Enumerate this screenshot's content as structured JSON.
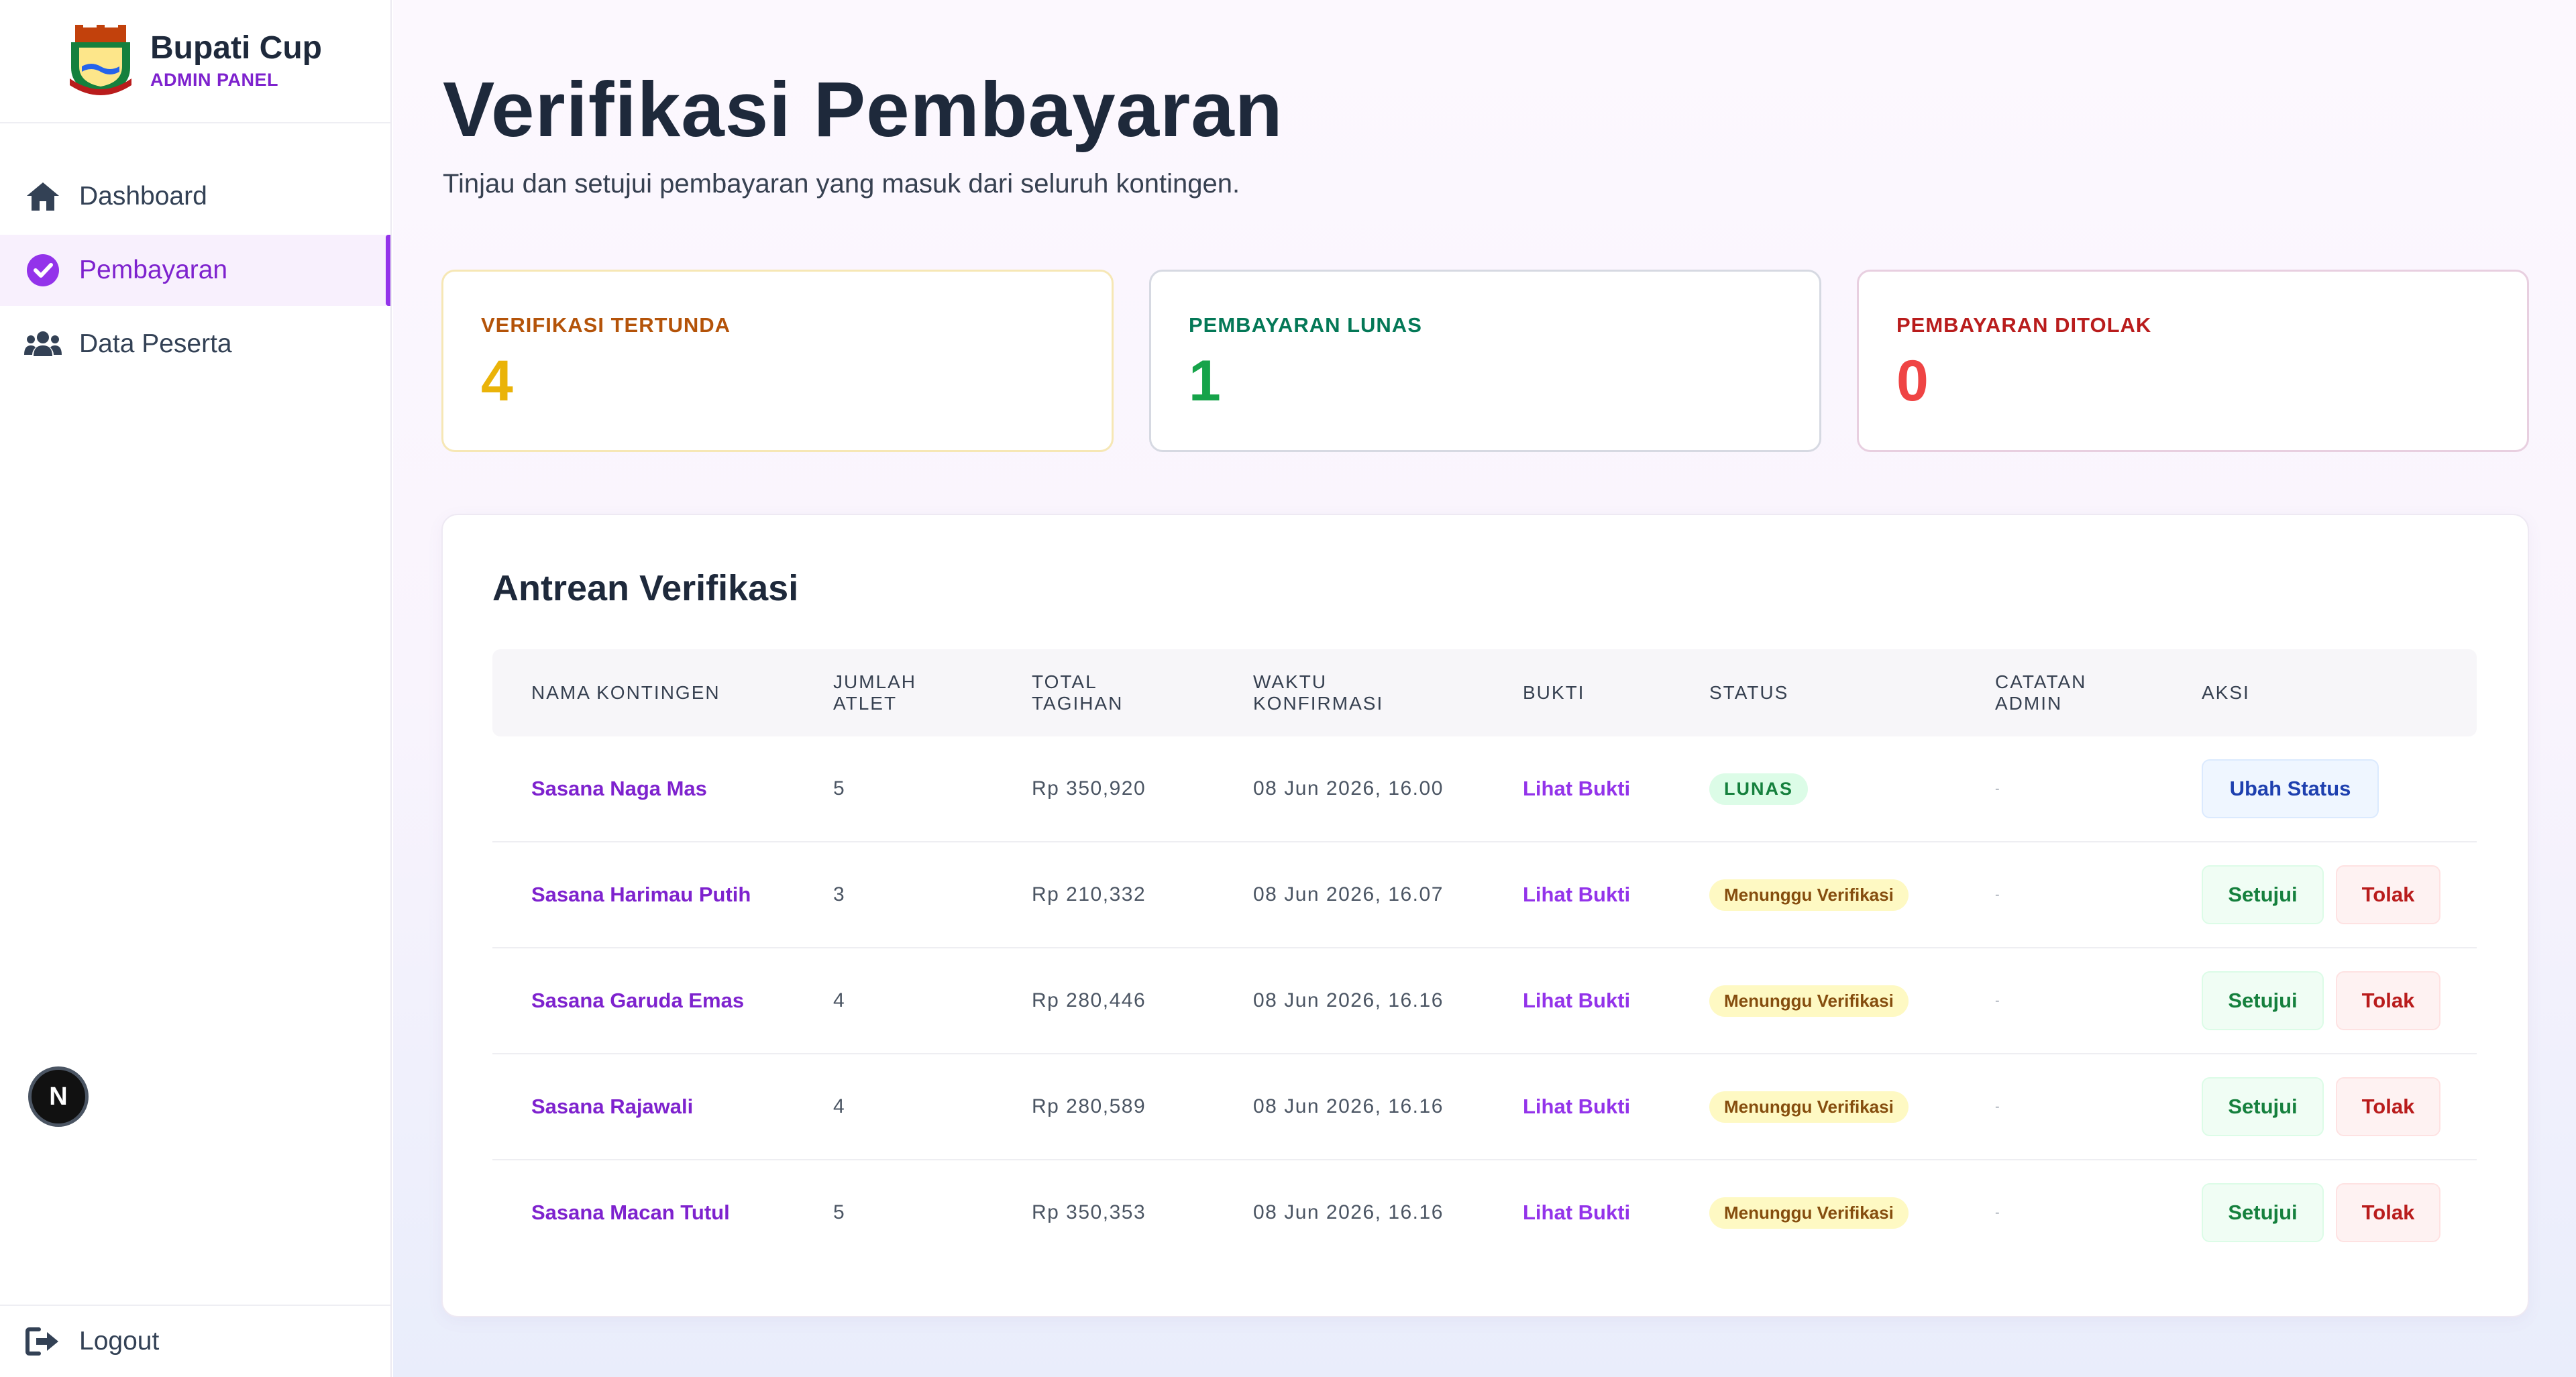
{
  "brand": {
    "title": "Bupati Cup",
    "subtitle": "ADMIN PANEL"
  },
  "nav": [
    {
      "label": "Dashboard",
      "icon": "home-icon",
      "active": false
    },
    {
      "label": "Pembayaran",
      "icon": "check-circle-icon",
      "active": true
    },
    {
      "label": "Data Peserta",
      "icon": "users-icon",
      "active": false
    }
  ],
  "dev_badge": "N",
  "logout_label": "Logout",
  "page": {
    "title": "Verifikasi Pembayaran",
    "subtitle": "Tinjau dan setujui pembayaran yang masuk dari seluruh kontingen."
  },
  "stats": {
    "pending": {
      "label": "VERIFIKASI TERTUNDA",
      "value": "4",
      "color": "#eab308"
    },
    "paid": {
      "label": "PEMBAYARAN LUNAS",
      "value": "1",
      "color": "#16a34a"
    },
    "rejected": {
      "label": "PEMBAYARAN DITOLAK",
      "value": "0",
      "color": "#ef4444"
    }
  },
  "queue": {
    "title": "Antrean Verifikasi",
    "headers": {
      "name": "NAMA KONTINGEN",
      "athletes_1": "JUMLAH",
      "athletes_2": "ATLET",
      "total_1": "TOTAL",
      "total_2": "TAGIHAN",
      "time_1": "WAKTU",
      "time_2": "KONFIRMASI",
      "proof": "BUKTI",
      "status": "STATUS",
      "note_1": "CATATAN",
      "note_2": "ADMIN",
      "action": "AKSI"
    },
    "rows": [
      {
        "name": "Sasana Naga Mas",
        "athletes": "5",
        "total": "Rp 350,920",
        "time": "08 Jun 2026, 16.00",
        "proof": "Lihat Bukti",
        "status": "LUNAS",
        "note": "-",
        "actions": [
          "Ubah Status"
        ]
      },
      {
        "name": "Sasana Harimau Putih",
        "athletes": "3",
        "total": "Rp 210,332",
        "time": "08 Jun 2026, 16.07",
        "proof": "Lihat Bukti",
        "status": "Menunggu Verifikasi",
        "note": "-",
        "actions": [
          "Setujui",
          "Tolak"
        ]
      },
      {
        "name": "Sasana Garuda Emas",
        "athletes": "4",
        "total": "Rp 280,446",
        "time": "08 Jun 2026, 16.16",
        "proof": "Lihat Bukti",
        "status": "Menunggu Verifikasi",
        "note": "-",
        "actions": [
          "Setujui",
          "Tolak"
        ]
      },
      {
        "name": "Sasana Rajawali",
        "athletes": "4",
        "total": "Rp 280,589",
        "time": "08 Jun 2026, 16.16",
        "proof": "Lihat Bukti",
        "status": "Menunggu Verifikasi",
        "note": "-",
        "actions": [
          "Setujui",
          "Tolak"
        ]
      },
      {
        "name": "Sasana Macan Tutul",
        "athletes": "5",
        "total": "Rp 350,353",
        "time": "08 Jun 2026, 16.16",
        "proof": "Lihat Bukti",
        "status": "Menunggu Verifikasi",
        "note": "-",
        "actions": [
          "Setujui",
          "Tolak"
        ]
      }
    ]
  }
}
